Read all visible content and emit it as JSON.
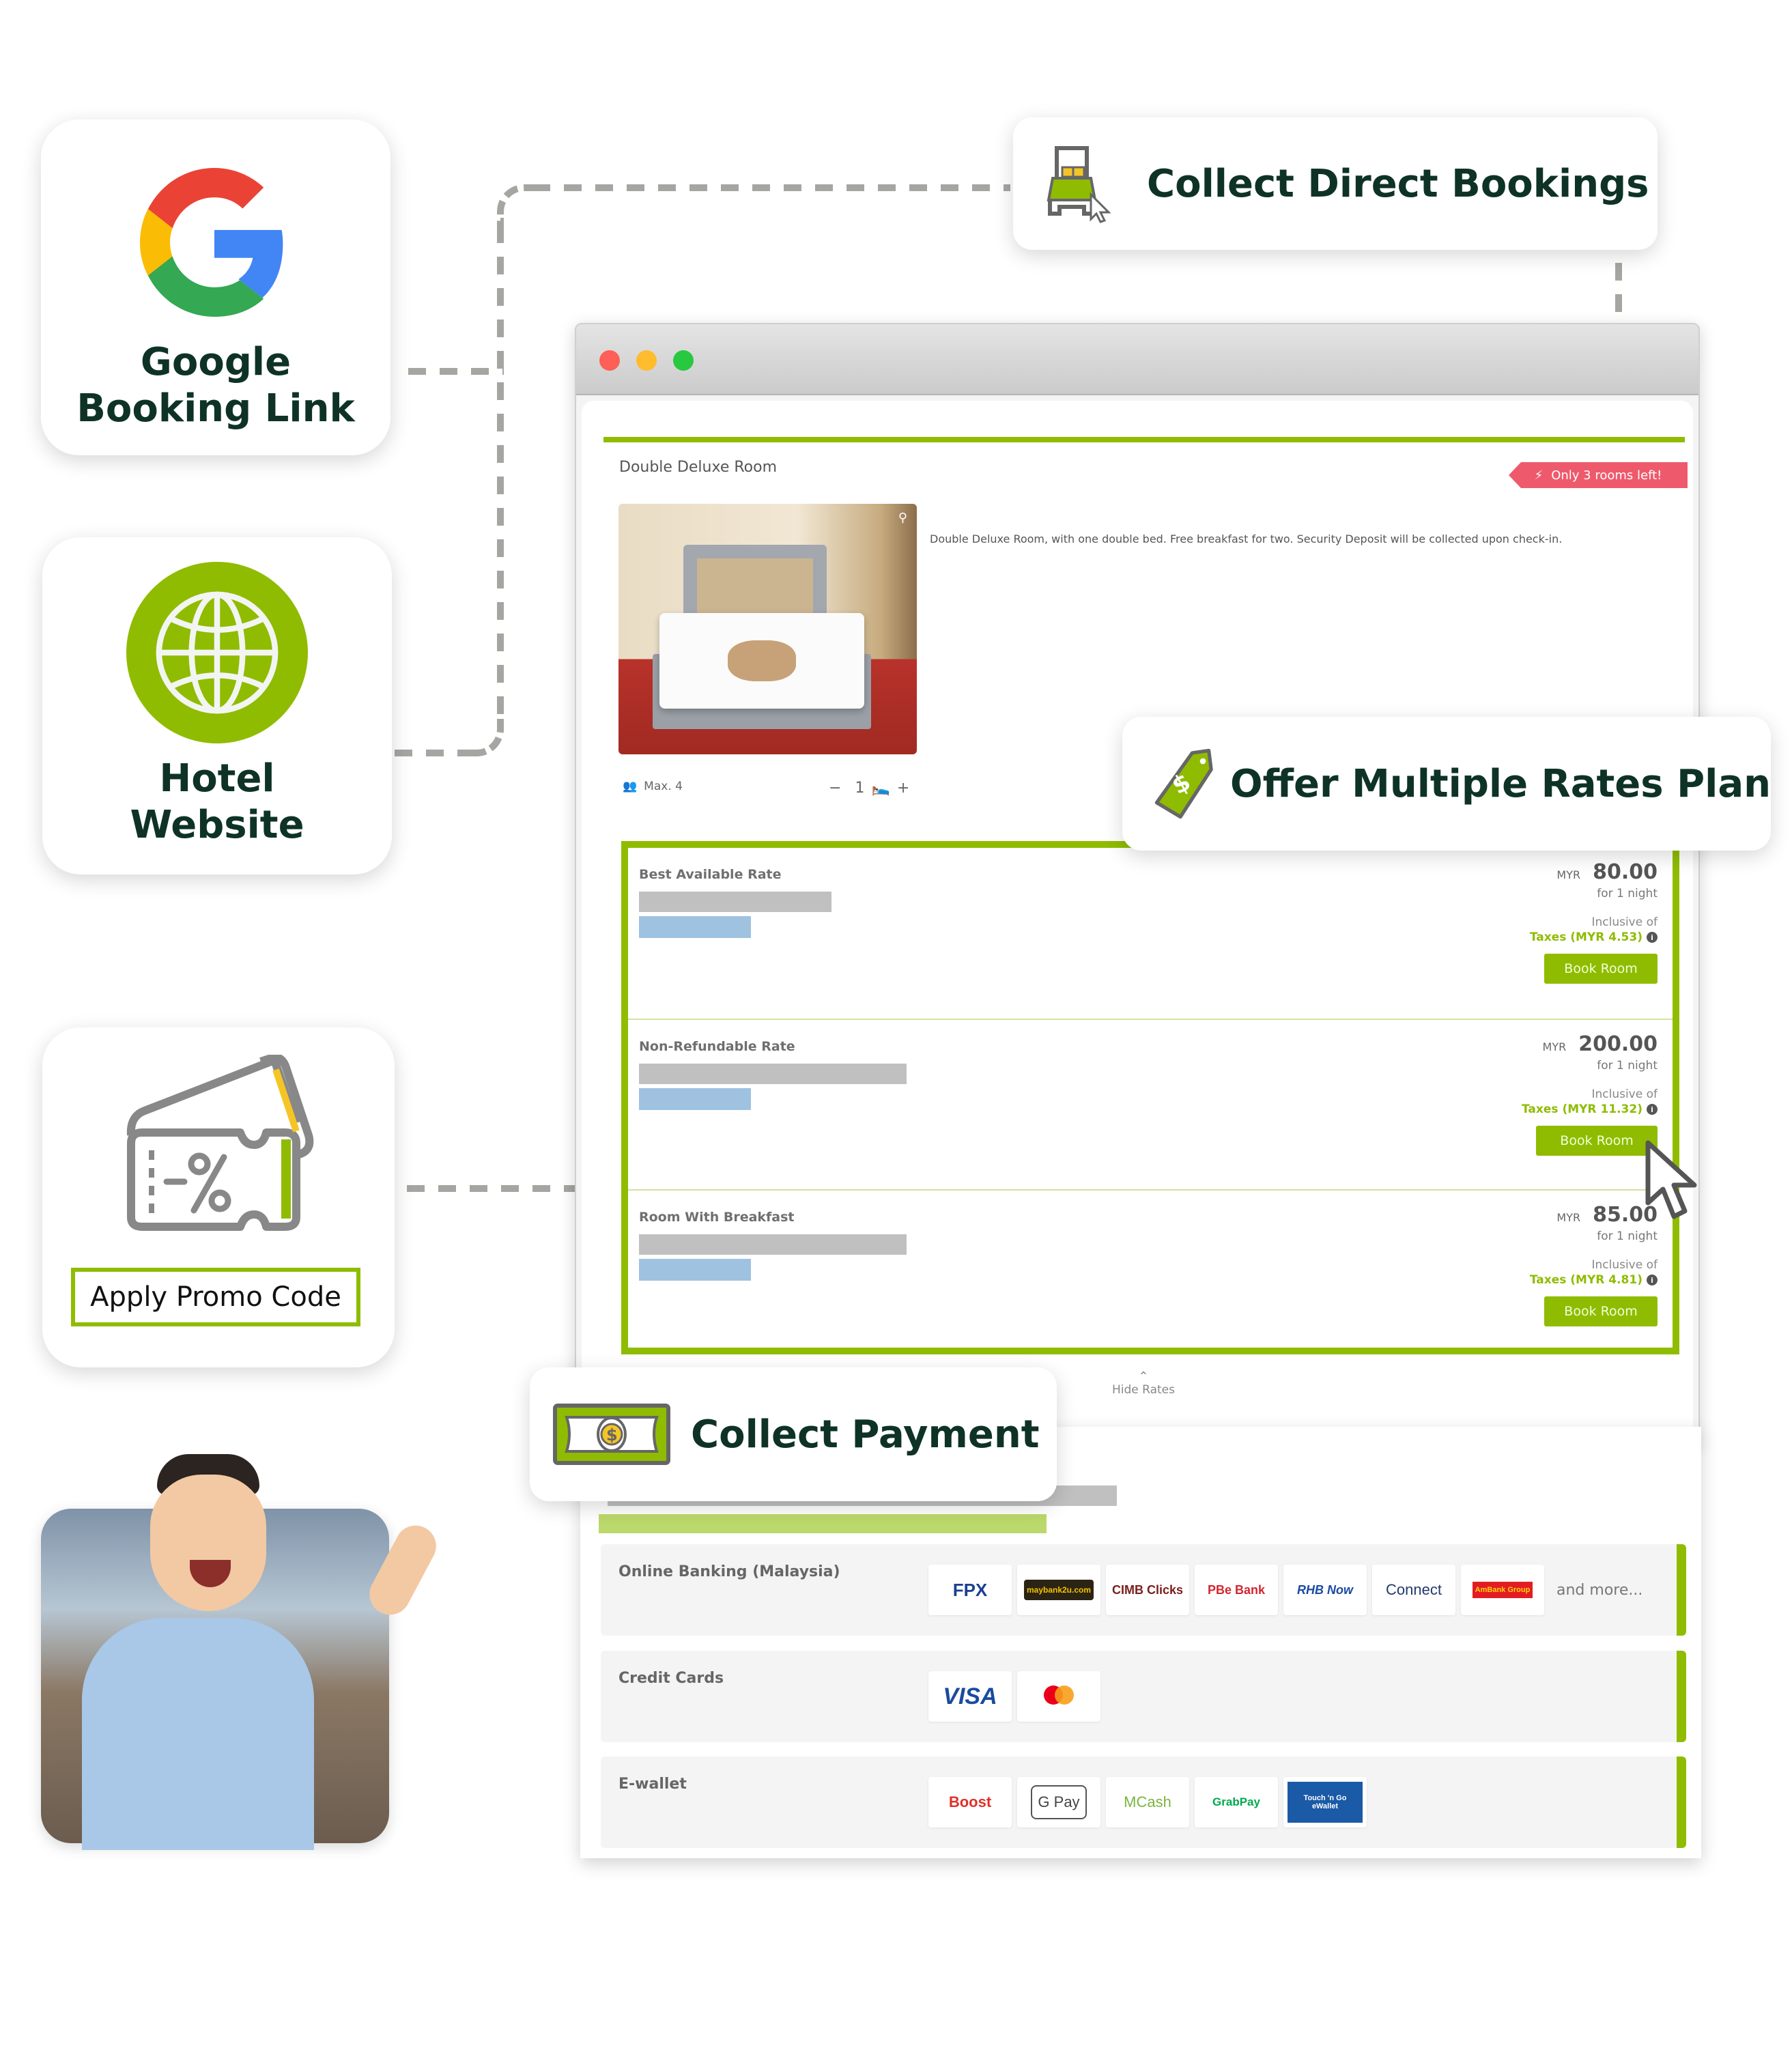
{
  "sources": [
    {
      "label_line1": "Google",
      "label_line2": "Booking Link",
      "icon": "google-g-icon"
    },
    {
      "label_line1": "Hotel",
      "label_line2": "Website",
      "icon": "globe-icon"
    }
  ],
  "promo": {
    "label": "Apply Promo Code",
    "icon": "discount-ticket-icon"
  },
  "callouts": {
    "direct_bookings": "Collect Direct Bookings",
    "rates_plan": "Offer Multiple Rates Plan",
    "payment": "Collect Payment"
  },
  "room": {
    "title": "Double Deluxe Room",
    "availability_badge": "Only 3 rooms left!",
    "description": "Double Deluxe Room, with one double bed. Free breakfast for two. Security Deposit will be collected upon check-in.",
    "max_guests": "Max. 4",
    "room_qty": "1",
    "decrement": "−",
    "increment": "+"
  },
  "rates": [
    {
      "name": "Best Available Rate",
      "currency": "MYR",
      "price": "80.00",
      "per": "for 1 night",
      "inclusive": "Inclusive of",
      "taxes": "Taxes (MYR 4.53)",
      "button": "Book Room"
    },
    {
      "name": "Non-Refundable Rate",
      "currency": "MYR",
      "price": "200.00",
      "per": "for 1 night",
      "inclusive": "Inclusive of",
      "taxes": "Taxes (MYR 11.32)",
      "button": "Book Room"
    },
    {
      "name": "Room With Breakfast",
      "currency": "MYR",
      "price": "85.00",
      "per": "for 1 night",
      "inclusive": "Inclusive of",
      "taxes": "Taxes (MYR 4.81)",
      "button": "Book Room"
    }
  ],
  "hide_rates": "Hide Rates",
  "payment_methods": [
    {
      "category": "Online Banking (Malaysia)",
      "logos": [
        "FPX",
        "maybank2u.com",
        "CIMB Clicks",
        "PBe Bank",
        "RHB Now",
        "Connect",
        "AmBank Group"
      ],
      "more": "and more..."
    },
    {
      "category": "Credit Cards",
      "logos": [
        "VISA",
        "mastercard"
      ]
    },
    {
      "category": "E-wallet",
      "logos": [
        "Boost",
        "G Pay",
        "MCash",
        "GrabPay",
        "Touch 'n Go eWallet"
      ]
    }
  ],
  "colors": {
    "brand_green": "#8fbc00",
    "heading_dark": "#0e3326",
    "badge_red": "#ee5a6c",
    "dash_grey": "#a5a6a1"
  }
}
